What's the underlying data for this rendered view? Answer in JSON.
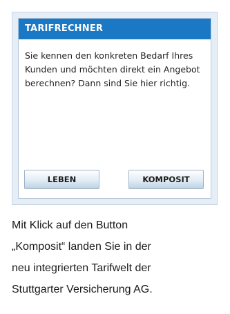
{
  "widget": {
    "title": "TARIFRECHNER",
    "description": "Sie kennen den konkreten Bedarf Ihres Kunden und möchten direkt ein Angebot berechnen? Dann sind Sie hier richtig.",
    "buttons": {
      "leben": "LEBEN",
      "komposit": "KOMPOSIT"
    }
  },
  "caption": {
    "lines": [
      "Mit Klick auf den Button",
      "„Komposit“ landen Sie in der",
      "neu integrierten Tarifwelt der",
      "Stuttgarter Versicherung AG."
    ]
  },
  "colors": {
    "header": "#1a78c4",
    "frame": "#e5eef6"
  }
}
